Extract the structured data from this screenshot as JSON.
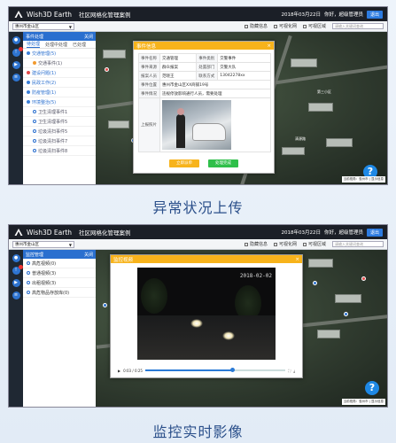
{
  "captions": {
    "top": "异常状况上传",
    "bottom": "监控实时影像"
  },
  "app": {
    "name": "Wish3D Earth",
    "system_title": "社区网格化管理案例",
    "time": "2018年03月22日",
    "user": "你好，超级管理员",
    "user_button": "退出",
    "region": "惠州市金山区",
    "toolbar_checks": [
      "隐藏信息",
      "可视化网",
      "可视区域"
    ],
    "search_placeholder": "请输入关键词查询"
  },
  "screen1": {
    "panel_title": "事件处理",
    "panel_action": "关闭",
    "tabs": [
      "待处理",
      "处理中处理",
      "已处理"
    ],
    "tree": [
      {
        "label": "交通管理(5)",
        "type": "group",
        "dot": "blue"
      },
      {
        "label": "交通事件(1)",
        "type": "child",
        "dot": "orange"
      },
      {
        "label": "建设问题(1)",
        "type": "group",
        "dot": "red"
      },
      {
        "label": "民政工作(2)",
        "type": "group",
        "dot": "blue"
      },
      {
        "label": "防疫管理(1)",
        "type": "group",
        "dot": "blue"
      },
      {
        "label": "环境整治(5)",
        "type": "group",
        "dot": "blue"
      },
      {
        "label": "卫生清理事件1",
        "type": "child",
        "dot": "gray"
      },
      {
        "label": "卫生清理事件5",
        "type": "child",
        "dot": "gray"
      },
      {
        "label": "垃圾清扫事件5",
        "type": "child",
        "dot": "gray"
      },
      {
        "label": "垃圾清扫事件7",
        "type": "child",
        "dot": "gray"
      },
      {
        "label": "垃圾清扫事件8",
        "type": "child",
        "dot": "gray"
      }
    ],
    "popup": {
      "title": "事件信息",
      "close": "×",
      "rows": [
        [
          "事件名称",
          "交通管理",
          "事件类别",
          "交警事件"
        ],
        [
          "事件来源",
          "群众报案",
          "处置部门",
          "交警大队"
        ],
        [
          "报案人员",
          "范晓王",
          "联系方式",
          "13042278xx"
        ]
      ],
      "location_label": "事件位置",
      "location_value": "惠州市金山区XX商铺19号",
      "desc_label": "事件情况",
      "desc_value": "违规停放影响通行人员，需要处理",
      "photo_label": "上报照片",
      "btn_left": "立即派单",
      "btn_right": "处理完成"
    },
    "map_labels": [
      "清源路",
      "第三小区"
    ],
    "status": "当前视角：惠州市 | 显示信息"
  },
  "screen2": {
    "panel_title": "监控管理",
    "panel_action": "关闭",
    "tree": [
      {
        "label": "高危视频(0)",
        "dot": "gray"
      },
      {
        "label": "普通视频(3)",
        "dot": "gray"
      },
      {
        "label": "出租视频(3)",
        "dot": "gray"
      },
      {
        "label": "高危物品存放库(0)",
        "dot": "gray"
      }
    ],
    "popup": {
      "title": "监控视频",
      "close": "×",
      "timestamp": "2018-02-02",
      "time_display": "0:03 / 0:25",
      "progress": 0.62
    },
    "status": "当前视角：惠州市 | 显示信息"
  }
}
